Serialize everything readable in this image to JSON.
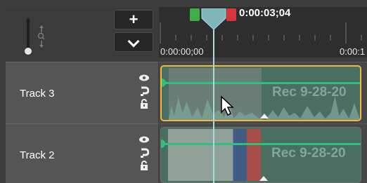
{
  "header": {
    "add_button": "+",
    "zoom_icon": "zoom-slider-icon"
  },
  "ruler": {
    "start_time": "0:00:00;00",
    "end_time_partial": "0:00:1"
  },
  "playhead": {
    "timecode": "0:00:03;04",
    "color": "#a8dde0"
  },
  "tracks": [
    {
      "name": "Track 3",
      "clip_label": "Rec 9-28-20",
      "selected": true
    },
    {
      "name": "Track 2",
      "clip_label": "Rec 9-28-20",
      "selected": false
    }
  ],
  "colors": {
    "selection": "#f0b93a",
    "audio_line": "#30c07a",
    "clip_fill": "#4b6e63",
    "marker_start": "#3fae48",
    "marker_end": "#d5373c"
  }
}
